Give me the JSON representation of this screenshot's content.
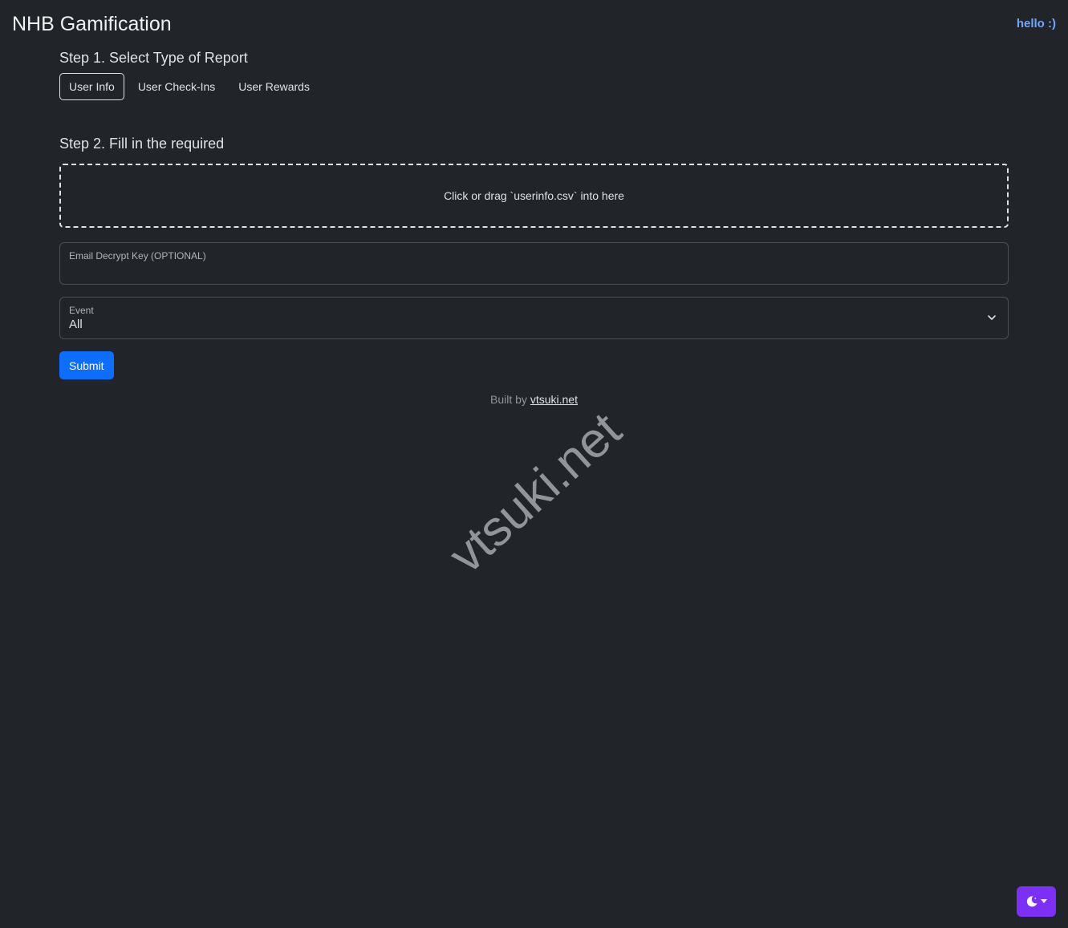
{
  "header": {
    "title": "NHB Gamification",
    "greeting": "hello :)"
  },
  "step1": {
    "heading": "Step 1. Select Type of Report",
    "tabs": [
      {
        "label": "User Info",
        "active": true
      },
      {
        "label": "User Check-Ins",
        "active": false
      },
      {
        "label": "User Rewards",
        "active": false
      }
    ]
  },
  "step2": {
    "heading": "Step 2. Fill in the required",
    "dropzone_text": "Click or drag `userinfo.csv` into here",
    "email_key": {
      "label": "Email Decrypt Key (OPTIONAL)",
      "value": ""
    },
    "event": {
      "label": "Event",
      "selected": "All"
    },
    "submit_label": "Submit"
  },
  "footer": {
    "prefix": "Built by",
    "link_text": "vtsuki.net"
  },
  "watermark": "vtsuki.net",
  "theme_toggle": {
    "icon": "moon-icon",
    "color": "#7b2ff7"
  }
}
